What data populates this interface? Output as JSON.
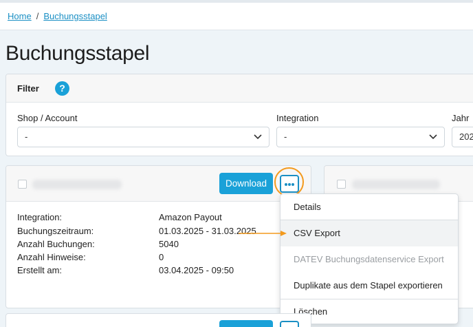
{
  "breadcrumb": {
    "home": "Home",
    "separator": "/",
    "current": "Buchungsstapel"
  },
  "page": {
    "title": "Buchungsstapel"
  },
  "filter": {
    "title": "Filter",
    "help_icon": "?",
    "fields": [
      {
        "label": "Shop / Account",
        "value": "-"
      },
      {
        "label": "Integration",
        "value": "-"
      },
      {
        "label": "Jahr",
        "value": "202"
      }
    ]
  },
  "card": {
    "download_label": "Download",
    "more_icon": "ellipsis-icon",
    "info": [
      {
        "label": "Integration:",
        "value": "Amazon Payout"
      },
      {
        "label": "Buchungszeitraum:",
        "value": "01.03.2025 - 31.03.2025"
      },
      {
        "label": "Anzahl Buchungen:",
        "value": "5040"
      },
      {
        "label": "Anzahl Hinweise:",
        "value": "0"
      },
      {
        "label": "Erstellt am:",
        "value": "03.04.2025 - 09:50"
      }
    ]
  },
  "menu": {
    "items": [
      {
        "label": "Details",
        "state": "normal"
      },
      {
        "label": "CSV Export",
        "state": "selected"
      },
      {
        "label": "DATEV Buchungsdatenservice Export",
        "state": "disabled"
      },
      {
        "label": "Duplikate aus dem Stapel exportieren",
        "state": "normal"
      },
      {
        "label": "Löschen",
        "state": "normal"
      }
    ]
  },
  "colors": {
    "accent": "#1aa1d8",
    "link": "#1a8fc4",
    "highlight": "#f39a1d"
  }
}
